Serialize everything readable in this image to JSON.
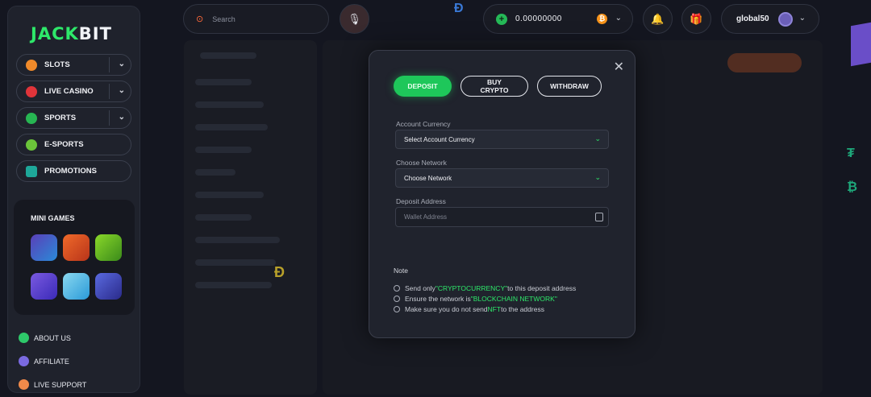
{
  "brand": {
    "logo_part1": "JACK",
    "logo_part2": "BIT"
  },
  "sidebar": {
    "items": [
      {
        "label": "SLOTS"
      },
      {
        "label": "LIVE CASINO"
      },
      {
        "label": "SPORTS"
      },
      {
        "label": "E-SPORTS"
      },
      {
        "label": "PROMOTIONS"
      }
    ],
    "mini_games_title": "MINI GAMES",
    "footer": [
      {
        "label": "ABOUT US"
      },
      {
        "label": "AFFILIATE"
      },
      {
        "label": "LIVE SUPPORT"
      }
    ]
  },
  "topbar": {
    "search_placeholder": "Search",
    "balance": "0.00000000",
    "currency_symbol": "₿",
    "username": "global50"
  },
  "modal": {
    "tabs": [
      {
        "label": "DEPOSIT",
        "active": true
      },
      {
        "label": "BUY CRYPTO",
        "active": false
      },
      {
        "label": "WITHDRAW",
        "active": false
      }
    ],
    "account_currency_label": "Account Currency",
    "account_currency_value": "Select Account Currency",
    "network_label": "Choose Network",
    "network_value": "Choose Network",
    "address_label": "Deposit Address",
    "address_placeholder": "Wallet Address",
    "note_title": "Note",
    "notes": [
      {
        "pre": "Send only ",
        "hl": "\"CRYPTOCURRENCY\"",
        "post": " to this deposit address"
      },
      {
        "pre": "Ensure the network is ",
        "hl": "\"BLOCKCHAIN NETWORK\"",
        "post": ""
      },
      {
        "pre": "Make sure you do not send ",
        "hl": "NFT",
        "post": " to the address"
      }
    ]
  },
  "colors": {
    "accent": "#1ec75a",
    "background": "#141620",
    "panel": "#20232d"
  },
  "icons": [
    "search-icon",
    "podcast-icon",
    "bell-icon",
    "gift-icon",
    "close-icon",
    "copy-icon",
    "bitcoin-icon",
    "chevron-down-icon"
  ]
}
